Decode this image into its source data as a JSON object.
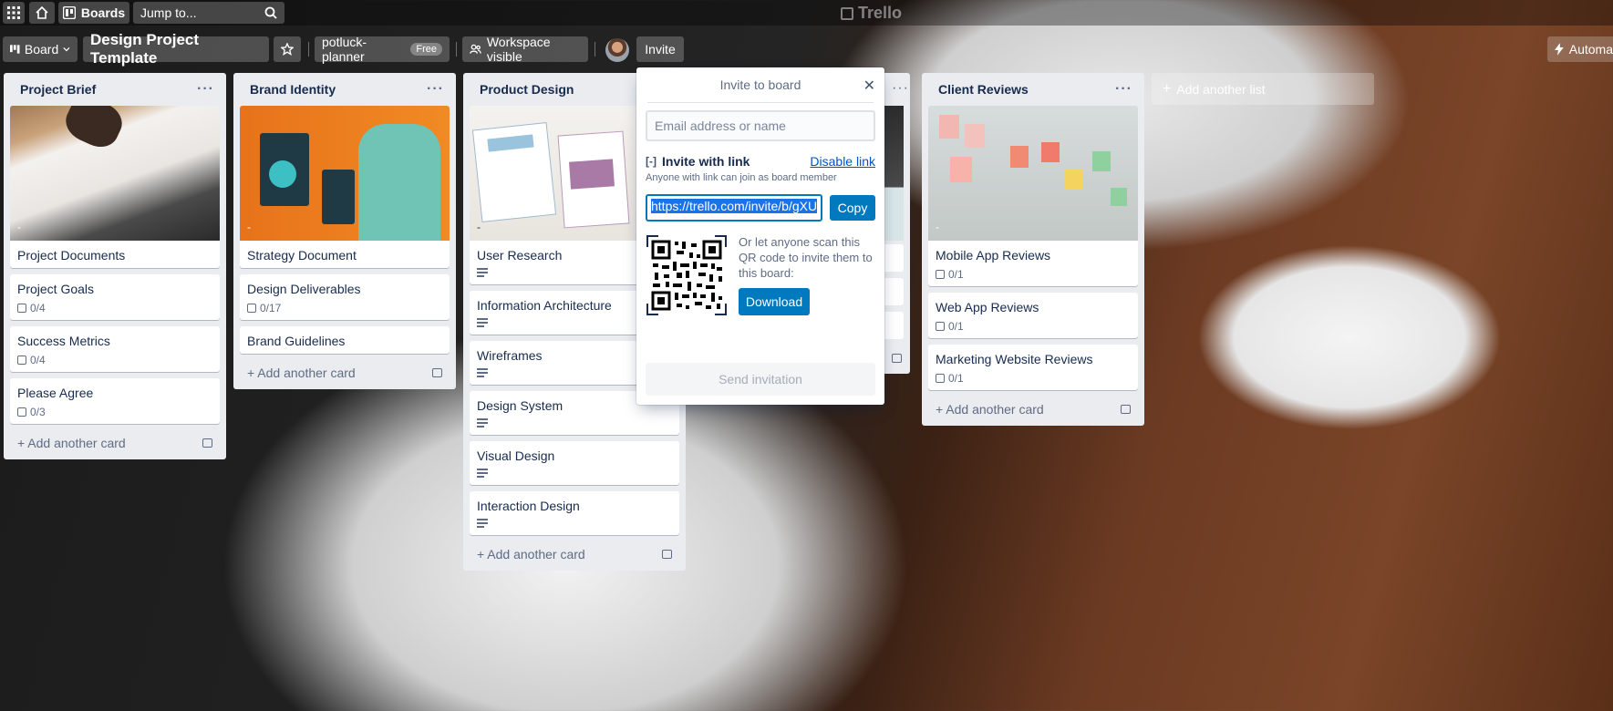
{
  "topbar": {
    "boards_label": "Boards",
    "search_placeholder": "Jump to...",
    "logo": "Trello"
  },
  "boardbar": {
    "view_label": "Board",
    "board_title": "Design Project Template",
    "workspace_name": "potluck-planner",
    "plan_badge": "Free",
    "visibility_label": "Workspace visible",
    "invite_label": "Invite",
    "automation_label": "Automa"
  },
  "lists": [
    {
      "title": "Project Brief",
      "cover_label": "-",
      "cards": [
        {
          "title": "Project Documents",
          "badge": ""
        },
        {
          "title": "Project Goals",
          "badge": "0/4"
        },
        {
          "title": "Success Metrics",
          "badge": "0/4"
        },
        {
          "title": "Please Agree",
          "badge": "0/3"
        }
      ],
      "add_card": "Add another card"
    },
    {
      "title": "Brand Identity",
      "cover_label": "-",
      "cards": [
        {
          "title": "Strategy Document",
          "badge": ""
        },
        {
          "title": "Design Deliverables",
          "badge": "0/17"
        },
        {
          "title": "Brand Guidelines",
          "badge": ""
        }
      ],
      "add_card": "Add another card"
    },
    {
      "title": "Product Design",
      "cover_label": "-",
      "cards": [
        {
          "title": "User Research"
        },
        {
          "title": "Information Architecture"
        },
        {
          "title": "Wireframes"
        },
        {
          "title": "Design System"
        },
        {
          "title": "Visual Design"
        },
        {
          "title": "Interaction Design"
        }
      ],
      "add_card": "Add another card"
    },
    {
      "title": "Client Reviews",
      "cover_label": "-",
      "cards": [
        {
          "title": "Mobile App Reviews",
          "badge": "0/1"
        },
        {
          "title": "Web App Reviews",
          "badge": "0/1"
        },
        {
          "title": "Marketing Website Reviews",
          "badge": "0/1"
        }
      ],
      "add_card": "Add another card"
    }
  ],
  "add_list": "Add another list",
  "invite_popover": {
    "title": "Invite to board",
    "email_placeholder": "Email address or name",
    "invite_with_link": "Invite with link",
    "disable_link": "Disable link",
    "link_description": "Anyone with link can join as board member",
    "link_value": "https://trello.com/invite/b/gXU",
    "copy_label": "Copy",
    "qr_text": "Or let anyone scan this QR code to invite them to this board:",
    "download_label": "Download",
    "send_label": "Send invitation"
  },
  "colors": {
    "accent": "#0079bf",
    "list_bg": "#ebecf0",
    "selection": "#1a73e8"
  }
}
